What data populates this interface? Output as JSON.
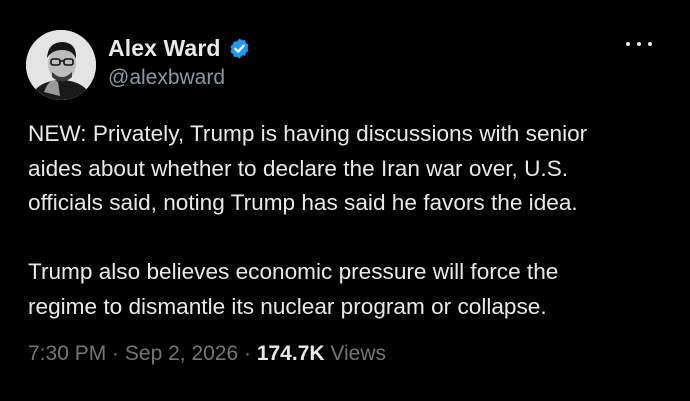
{
  "author": {
    "display_name": "Alex Ward",
    "handle": "@alexbward",
    "verified": true,
    "verified_color": "#1d9bf0",
    "avatar_icon": "profile-photo"
  },
  "menu": {
    "icon": "more-horizontal-icon"
  },
  "tweet": {
    "paragraph_1": [
      "NEW: Privately, Trump is having discussions with senior",
      "aides about whether to declare the Iran war over, U.S.",
      "officials said, noting Trump has said he favors the idea."
    ],
    "paragraph_2": [
      "Trump also believes economic pressure will force the",
      "regime to dismantle its nuclear program or collapse."
    ]
  },
  "meta": {
    "time": "7:30 PM",
    "separator": " · ",
    "date": "Sep 2, 2026",
    "views_count": "174.7K",
    "views_label": " Views"
  },
  "colors": {
    "background": "#000000",
    "primary_text": "#e7e9ea",
    "secondary_text": "#71767b"
  }
}
